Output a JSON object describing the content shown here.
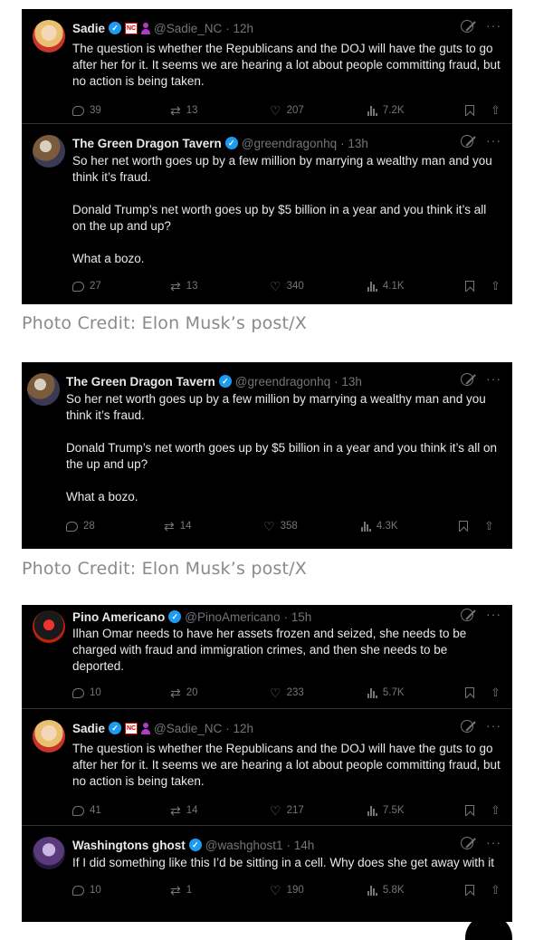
{
  "colors": {
    "tweet_bg": "#000000",
    "text": "#e7e9ea",
    "muted": "#71767b",
    "verified": "#1d9bf0",
    "credit": "#8a8a8a"
  },
  "credits": [
    "Photo Credit: Elon Musk’s post/X",
    "Photo Credit: Elon Musk’s post/X"
  ],
  "shots": [
    {
      "tweets": [
        {
          "name": "Sadie",
          "handle": "@Sadie_NC",
          "time": "· 12h",
          "badges": [
            "verified-icon",
            "nc-flag-icon",
            "person-icon"
          ],
          "text": "The question is whether the Republicans and the DOJ will have the guts to go after her for it. It seems we are hearing a lot about people committing fraud, but no action is being taken.",
          "replies": "39",
          "reposts": "13",
          "likes": "207",
          "views": "7.2K"
        },
        {
          "name": "The Green Dragon Tavern",
          "handle": "@greendragonhq",
          "time": "· 13h",
          "badges": [
            "verified-icon"
          ],
          "text": "So her net worth goes up by a few million by marrying a wealthy man and you think it’s fraud.\n\nDonald Trump’s net worth goes up by $5 billion in a year and you think it’s all on the up and up?\n\nWhat a bozo.",
          "replies": "27",
          "reposts": "13",
          "likes": "340",
          "views": "4.1K"
        }
      ]
    },
    {
      "tweets": [
        {
          "name": "The Green Dragon Tavern",
          "handle": "@greendragonhq",
          "time": "· 13h",
          "badges": [
            "verified-icon"
          ],
          "text": "So her net worth goes up by a few million by marrying a wealthy man and you think it’s fraud.\n\nDonald Trump’s net worth goes up by $5 billion in a year and you think it’s all on the up and up?\n\nWhat a bozo.",
          "replies": "28",
          "reposts": "14",
          "likes": "358",
          "views": "4.3K"
        }
      ]
    },
    {
      "tweets": [
        {
          "name": "Pino Americano",
          "handle": "@PinoAmericano",
          "time": "· 15h",
          "badges": [
            "verified-icon"
          ],
          "text": "Ilhan Omar needs to have her assets frozen and seized, she needs to be charged with fraud and immigration crimes, and then she needs to be deported.",
          "replies": "10",
          "reposts": "20",
          "likes": "233",
          "views": "5.7K"
        },
        {
          "name": "Sadie",
          "handle": "@Sadie_NC",
          "time": "· 12h",
          "badges": [
            "verified-icon",
            "nc-flag-icon",
            "person-icon"
          ],
          "text": "The question is whether the Republicans and the DOJ will have the guts to go after her for it. It seems we are hearing a lot about people committing fraud, but no action is being taken.",
          "replies": "41",
          "reposts": "14",
          "likes": "217",
          "views": "7.5K"
        },
        {
          "name": "Washingtons ghost",
          "handle": "@washghost1",
          "time": "· 14h",
          "badges": [
            "verified-icon"
          ],
          "text": "If I did something like this I’d be sitting in a cell. Why does she get away with it",
          "replies": "10",
          "reposts": "1",
          "likes": "190",
          "views": "5.8K"
        }
      ]
    }
  ],
  "nc_badge_text": "NC"
}
